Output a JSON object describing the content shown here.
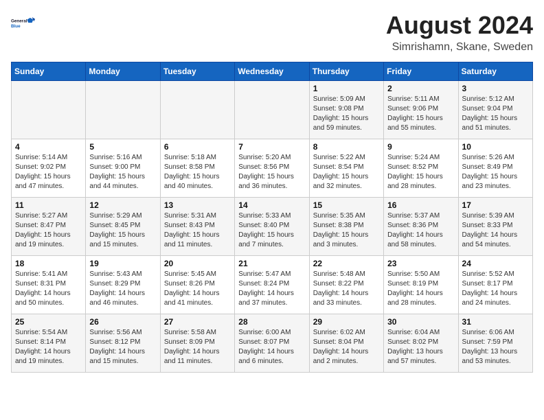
{
  "logo": {
    "line1": "General",
    "line2": "Blue"
  },
  "title": "August 2024",
  "location": "Simrishamn, Skane, Sweden",
  "days_of_week": [
    "Sunday",
    "Monday",
    "Tuesday",
    "Wednesday",
    "Thursday",
    "Friday",
    "Saturday"
  ],
  "weeks": [
    [
      {
        "day": "",
        "info": ""
      },
      {
        "day": "",
        "info": ""
      },
      {
        "day": "",
        "info": ""
      },
      {
        "day": "",
        "info": ""
      },
      {
        "day": "1",
        "info": "Sunrise: 5:09 AM\nSunset: 9:08 PM\nDaylight: 15 hours\nand 59 minutes."
      },
      {
        "day": "2",
        "info": "Sunrise: 5:11 AM\nSunset: 9:06 PM\nDaylight: 15 hours\nand 55 minutes."
      },
      {
        "day": "3",
        "info": "Sunrise: 5:12 AM\nSunset: 9:04 PM\nDaylight: 15 hours\nand 51 minutes."
      }
    ],
    [
      {
        "day": "4",
        "info": "Sunrise: 5:14 AM\nSunset: 9:02 PM\nDaylight: 15 hours\nand 47 minutes."
      },
      {
        "day": "5",
        "info": "Sunrise: 5:16 AM\nSunset: 9:00 PM\nDaylight: 15 hours\nand 44 minutes."
      },
      {
        "day": "6",
        "info": "Sunrise: 5:18 AM\nSunset: 8:58 PM\nDaylight: 15 hours\nand 40 minutes."
      },
      {
        "day": "7",
        "info": "Sunrise: 5:20 AM\nSunset: 8:56 PM\nDaylight: 15 hours\nand 36 minutes."
      },
      {
        "day": "8",
        "info": "Sunrise: 5:22 AM\nSunset: 8:54 PM\nDaylight: 15 hours\nand 32 minutes."
      },
      {
        "day": "9",
        "info": "Sunrise: 5:24 AM\nSunset: 8:52 PM\nDaylight: 15 hours\nand 28 minutes."
      },
      {
        "day": "10",
        "info": "Sunrise: 5:26 AM\nSunset: 8:49 PM\nDaylight: 15 hours\nand 23 minutes."
      }
    ],
    [
      {
        "day": "11",
        "info": "Sunrise: 5:27 AM\nSunset: 8:47 PM\nDaylight: 15 hours\nand 19 minutes."
      },
      {
        "day": "12",
        "info": "Sunrise: 5:29 AM\nSunset: 8:45 PM\nDaylight: 15 hours\nand 15 minutes."
      },
      {
        "day": "13",
        "info": "Sunrise: 5:31 AM\nSunset: 8:43 PM\nDaylight: 15 hours\nand 11 minutes."
      },
      {
        "day": "14",
        "info": "Sunrise: 5:33 AM\nSunset: 8:40 PM\nDaylight: 15 hours\nand 7 minutes."
      },
      {
        "day": "15",
        "info": "Sunrise: 5:35 AM\nSunset: 8:38 PM\nDaylight: 15 hours\nand 3 minutes."
      },
      {
        "day": "16",
        "info": "Sunrise: 5:37 AM\nSunset: 8:36 PM\nDaylight: 14 hours\nand 58 minutes."
      },
      {
        "day": "17",
        "info": "Sunrise: 5:39 AM\nSunset: 8:33 PM\nDaylight: 14 hours\nand 54 minutes."
      }
    ],
    [
      {
        "day": "18",
        "info": "Sunrise: 5:41 AM\nSunset: 8:31 PM\nDaylight: 14 hours\nand 50 minutes."
      },
      {
        "day": "19",
        "info": "Sunrise: 5:43 AM\nSunset: 8:29 PM\nDaylight: 14 hours\nand 46 minutes."
      },
      {
        "day": "20",
        "info": "Sunrise: 5:45 AM\nSunset: 8:26 PM\nDaylight: 14 hours\nand 41 minutes."
      },
      {
        "day": "21",
        "info": "Sunrise: 5:47 AM\nSunset: 8:24 PM\nDaylight: 14 hours\nand 37 minutes."
      },
      {
        "day": "22",
        "info": "Sunrise: 5:48 AM\nSunset: 8:22 PM\nDaylight: 14 hours\nand 33 minutes."
      },
      {
        "day": "23",
        "info": "Sunrise: 5:50 AM\nSunset: 8:19 PM\nDaylight: 14 hours\nand 28 minutes."
      },
      {
        "day": "24",
        "info": "Sunrise: 5:52 AM\nSunset: 8:17 PM\nDaylight: 14 hours\nand 24 minutes."
      }
    ],
    [
      {
        "day": "25",
        "info": "Sunrise: 5:54 AM\nSunset: 8:14 PM\nDaylight: 14 hours\nand 19 minutes."
      },
      {
        "day": "26",
        "info": "Sunrise: 5:56 AM\nSunset: 8:12 PM\nDaylight: 14 hours\nand 15 minutes."
      },
      {
        "day": "27",
        "info": "Sunrise: 5:58 AM\nSunset: 8:09 PM\nDaylight: 14 hours\nand 11 minutes."
      },
      {
        "day": "28",
        "info": "Sunrise: 6:00 AM\nSunset: 8:07 PM\nDaylight: 14 hours\nand 6 minutes."
      },
      {
        "day": "29",
        "info": "Sunrise: 6:02 AM\nSunset: 8:04 PM\nDaylight: 14 hours\nand 2 minutes."
      },
      {
        "day": "30",
        "info": "Sunrise: 6:04 AM\nSunset: 8:02 PM\nDaylight: 13 hours\nand 57 minutes."
      },
      {
        "day": "31",
        "info": "Sunrise: 6:06 AM\nSunset: 7:59 PM\nDaylight: 13 hours\nand 53 minutes."
      }
    ]
  ]
}
